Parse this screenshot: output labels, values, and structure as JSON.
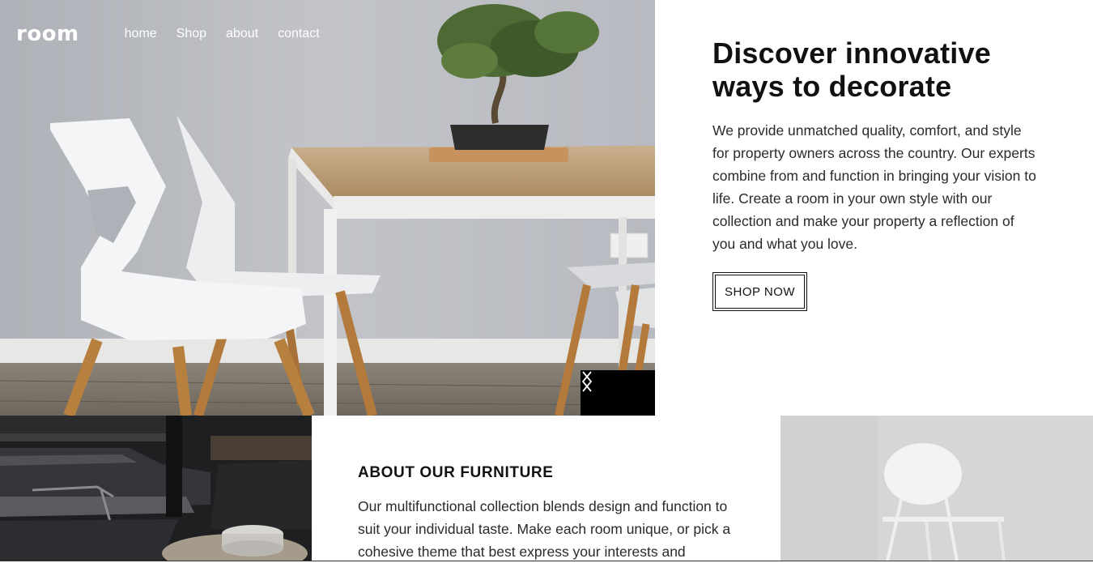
{
  "brand": {
    "logo": "room"
  },
  "nav": {
    "links": [
      {
        "label": "home"
      },
      {
        "label": "Shop"
      },
      {
        "label": "about"
      },
      {
        "label": "contact"
      }
    ]
  },
  "hero": {
    "title_line1": "Discover innovative",
    "title_line2": "ways to decorate",
    "description": "We provide unmatched quality, comfort, and style for property owners across the country. Our experts combine from and function in bringing your vision to life. Create a room in your own style with our collection and make your property a reflection of you and what you love.",
    "cta_label": "SHOP NOW",
    "slider": {
      "prev_icon": "chevron-left-icon",
      "next_icon": "chevron-right-icon"
    }
  },
  "about": {
    "title": "ABOUT OUR FURNITURE",
    "description": "Our multifunctional collection blends design and function to suit your individual taste. Make each room unique, or pick a cohesive theme that best express your interests and"
  },
  "colors": {
    "text_primary": "#111111",
    "slider_bg": "#000000",
    "hero_wall": "#b9bcc2"
  }
}
